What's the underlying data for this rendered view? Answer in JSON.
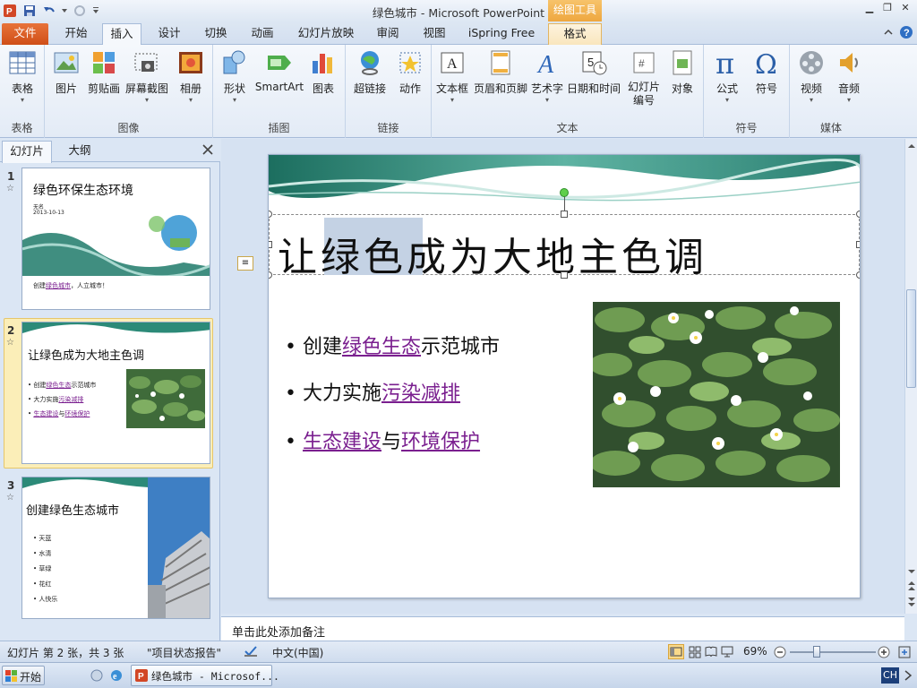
{
  "window": {
    "title": "绿色城市 - Microsoft PowerPoint",
    "context_tab_group": "绘图工具"
  },
  "tabs": [
    "文件",
    "开始",
    "插入",
    "设计",
    "切换",
    "动画",
    "幻灯片放映",
    "审阅",
    "视图",
    "iSpring Free",
    "格式"
  ],
  "ribbon": {
    "groups": [
      {
        "title": "表格",
        "buttons": [
          "表格"
        ]
      },
      {
        "title": "图像",
        "buttons": [
          "图片",
          "剪贴画",
          "屏幕截图",
          "相册"
        ]
      },
      {
        "title": "插图",
        "buttons": [
          "形状",
          "SmartArt",
          "图表"
        ]
      },
      {
        "title": "链接",
        "buttons": [
          "超链接",
          "动作"
        ]
      },
      {
        "title": "文本",
        "buttons": [
          "文本框",
          "页眉和页脚",
          "艺术字",
          "日期和时间",
          "幻灯片\n编号",
          "对象"
        ]
      },
      {
        "title": "符号",
        "buttons": [
          "公式",
          "符号"
        ]
      },
      {
        "title": "媒体",
        "buttons": [
          "视频",
          "音频"
        ]
      }
    ]
  },
  "left_panel": {
    "tabs": [
      "幻灯片",
      "大纲"
    ],
    "thumbs": [
      {
        "num": "1",
        "title": "绿色环保生态环境",
        "sub1": "无名",
        "sub2": "2013-10-13",
        "footer_pre": "创建",
        "footer_link": "绿色城市",
        "footer_post": "，人立城市！"
      },
      {
        "num": "2",
        "title": "让绿色成为大地主色调",
        "b1_pre": "创建",
        "b1_link": "绿色生态",
        "b1_post": "示范城市",
        "b2_pre": "大力实施",
        "b2_link": "污染减排",
        "b3_link1": "生态建设",
        "b3_mid": "与",
        "b3_link2": "环境保护"
      },
      {
        "num": "3",
        "title": "创建绿色生态城市",
        "items": [
          "天蓝",
          "水清",
          "草绿",
          "花红",
          "人快乐"
        ]
      }
    ]
  },
  "slide": {
    "title_hl": "让绿色",
    "title_rest": "成为大地主色调",
    "bullets": [
      {
        "pre": "创建",
        "link": "绿色生态",
        "post": "示范城市"
      },
      {
        "pre": "大力实施",
        "link": "污染减排",
        "post": ""
      },
      {
        "link1": "生态建设",
        "mid": "与",
        "link2": "环境保护"
      }
    ]
  },
  "notes_placeholder": "单击此处添加备注",
  "status": {
    "slide_info": "幻灯片 第 2 张，共 3 张",
    "theme": "\"项目状态报告\"",
    "language": "中文(中国)",
    "zoom": "69%"
  },
  "taskbar": {
    "start": "开始",
    "task": "绿色城市 - Microsof...",
    "lang": "CH"
  }
}
